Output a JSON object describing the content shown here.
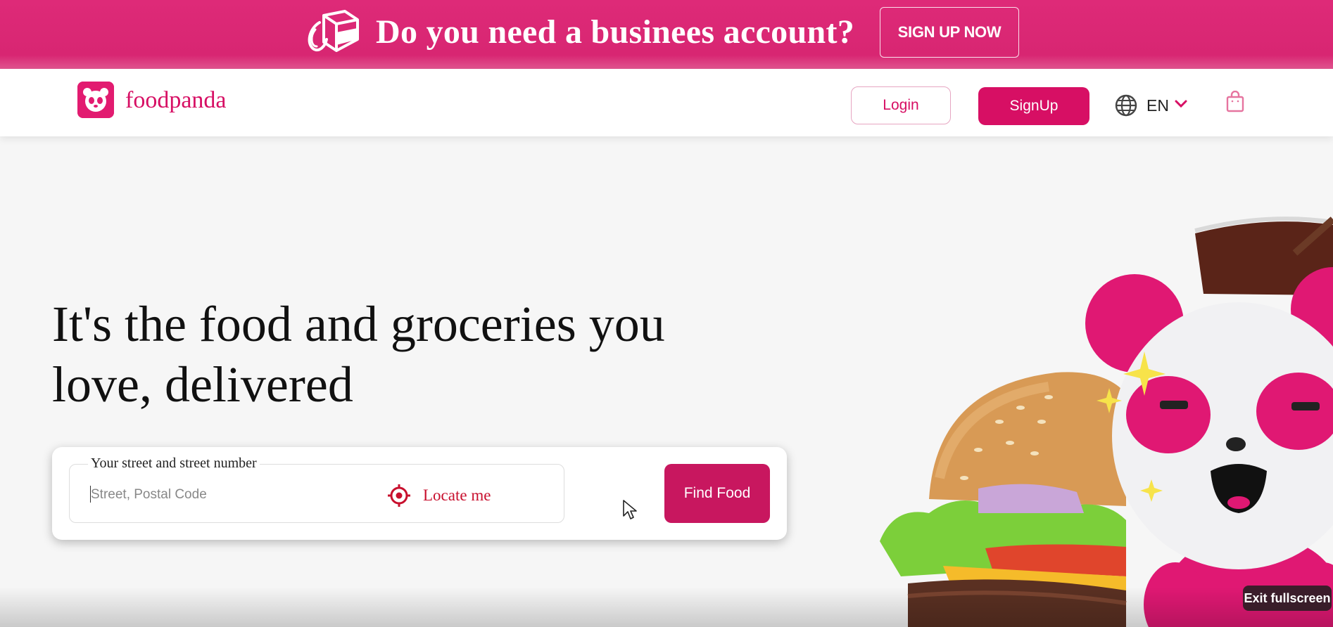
{
  "promo": {
    "text": "Do you need a businees account?",
    "button": "SIGN UP NOW"
  },
  "header": {
    "brand": "foodpanda",
    "login": "Login",
    "signup": "SignUp",
    "language": "EN"
  },
  "hero": {
    "title": "It's the food and groceries you love, delivered",
    "address_label": "Your street and street number",
    "address_placeholder": "Street, Postal Code",
    "address_value": "",
    "locate": "Locate me",
    "find_food": "Find Food"
  },
  "overlay": {
    "exit_fullscreen": "Exit fullscreen"
  },
  "colors": {
    "brand_pink": "#d70f64",
    "banner_pink": "#de2a78",
    "locate_red": "#c8102e"
  },
  "icons": [
    "bag-gift-icon",
    "panda-logo-icon",
    "globe-icon",
    "chevron-down-icon",
    "shopping-bag-icon",
    "crosshair-icon",
    "mouse-pointer-icon"
  ]
}
